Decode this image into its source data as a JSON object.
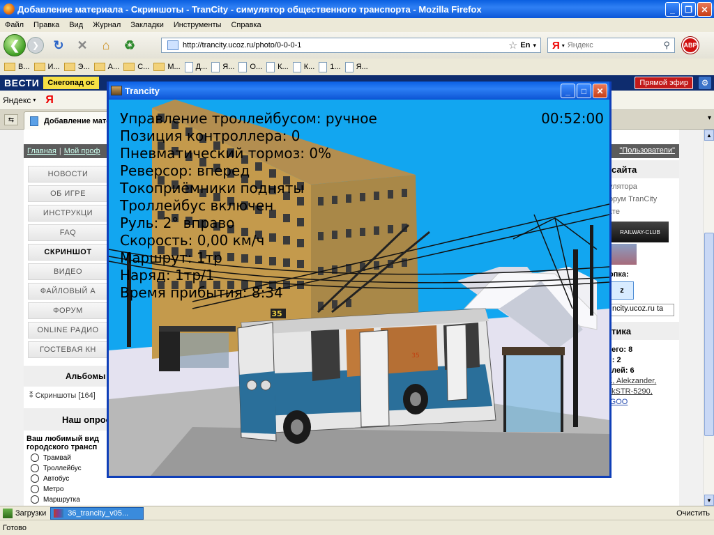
{
  "browser": {
    "title": "Добавление материала - Скриншоты - TranCity - симулятор общественного транспорта - Mozilla Firefox",
    "menu": [
      "Файл",
      "Правка",
      "Вид",
      "Журнал",
      "Закладки",
      "Инструменты",
      "Справка"
    ],
    "url": "http://trancity.ucoz.ru/photo/0-0-0-1",
    "url_lang": "En",
    "search_placeholder": "Яндекс",
    "search_logo": "Я",
    "abp_label": "ABP",
    "bookmarks": [
      {
        "label": "В...",
        "icon": "folder-icon"
      },
      {
        "label": "И...",
        "icon": "folder-icon"
      },
      {
        "label": "Э...",
        "icon": "folder-icon"
      },
      {
        "label": "А...",
        "icon": "folder-icon"
      },
      {
        "label": "С...",
        "icon": "folder-icon"
      },
      {
        "label": "М...",
        "icon": "folder-icon"
      },
      {
        "label": "Д...",
        "icon": "page-icon"
      },
      {
        "label": "Я...",
        "icon": "page-icon"
      },
      {
        "label": "О...",
        "icon": "page-icon"
      },
      {
        "label": "К...",
        "icon": "page-icon"
      },
      {
        "label": "К...",
        "icon": "page-icon"
      },
      {
        "label": "1...",
        "icon": "page-icon"
      },
      {
        "label": "Я...",
        "icon": "page-icon"
      }
    ],
    "vesti_logo": "ВЕСТИ",
    "vesti_news": "Снегопад ос",
    "vesti_live": "Прямой эфир",
    "yandex_label": "Яндекс",
    "yandex_logo": "Я",
    "tab_label": "Добавление мате",
    "status_text": "Готово",
    "downloads_label": "Загрузки",
    "task_label": "36_trancity_v05...",
    "clear_label": "Очистить"
  },
  "site": {
    "crumbs": [
      "Главная",
      "Мой проф"
    ],
    "users_link": "\"Пользователи\"",
    "nav": [
      {
        "label": "НОВОСТИ",
        "active": false
      },
      {
        "label": "ОБ ИГРЕ",
        "active": false
      },
      {
        "label": "ИНСТРУКЦИ",
        "active": false
      },
      {
        "label": "FAQ",
        "active": false
      },
      {
        "label": "СКРИНШОТ",
        "active": true
      },
      {
        "label": "ВИДЕО",
        "active": false
      },
      {
        "label": "ФАЙЛОВЫЙ А",
        "active": false
      },
      {
        "label": "ФОРУМ",
        "active": false
      },
      {
        "label": "ONLINE РАДИО",
        "active": false
      },
      {
        "label": "ГОСТЕВАЯ КН",
        "active": false
      }
    ],
    "albums_title": "Альбомы",
    "albums_item": "Скриншоты [164]",
    "poll_title": "Наш опрос",
    "poll_question": "Ваш любимый вид городского трансп",
    "poll_options": [
      "Трамвай",
      "Троллейбус",
      "Автобус",
      "Метро",
      "Маршрутка"
    ],
    "right_title": "сайта",
    "right_links": [
      "улятора",
      "орум TranCity",
      "кте"
    ],
    "railway_label": "RAILWAY-CLUB",
    "button_label": "опка:",
    "zbox": "z",
    "url_input": "ncity.ucoz.ru ta",
    "stats_title": "тика",
    "stats": {
      "total": "сего: 8",
      "guests": "й: 2",
      "users": "елей: 6",
      "names_1": "K, Alekzander,",
      "names_2": "ekSTR-5290,",
      "names_3": "rGOO"
    }
  },
  "trancity": {
    "window_title": "Trancity",
    "clock": "00:52:00",
    "hud": [
      "Управление троллейбусом: ручное",
      "Позиция контроллера: 0",
      "Пневматический тормоз: 0%",
      "Реверсор: вперед",
      "Токоприёмники подняты",
      "Троллейбус включен",
      "Руль: 2° вправо",
      "Скорость: 0,00 км/ч",
      "Маршрут: 1тр",
      "Наряд: 1тр/1",
      "Время прибытия: 8:34"
    ],
    "route_sign": "35",
    "side_sign": "35",
    "colors": {
      "sky": "#12a6f0",
      "bus_blue": "#2a6f9a",
      "bus_white": "#e6e6e6",
      "building": "#c49a4c"
    }
  }
}
